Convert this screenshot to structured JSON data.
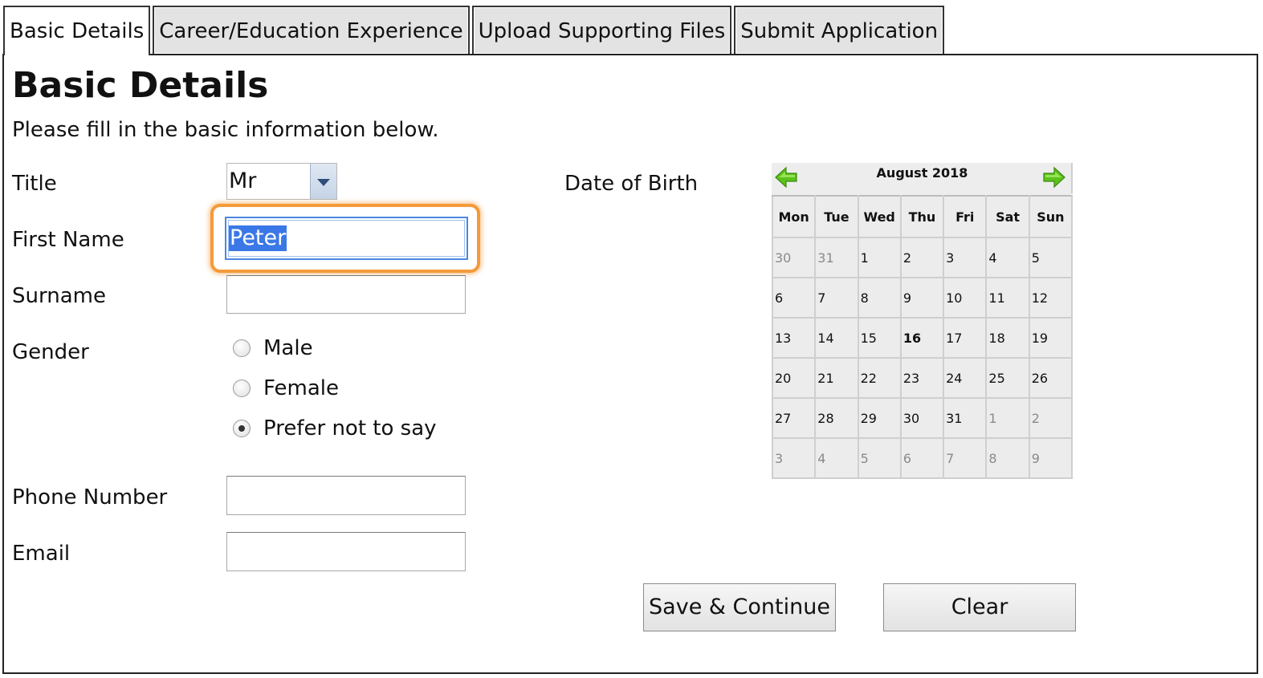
{
  "tabs": [
    {
      "label": "Basic Details"
    },
    {
      "label": "Career/Education Experience"
    },
    {
      "label": "Upload Supporting Files"
    },
    {
      "label": "Submit Application"
    }
  ],
  "page": {
    "title": "Basic Details",
    "instructions": "Please fill in the basic information below."
  },
  "form": {
    "title_label": "Title",
    "title_value": "Mr",
    "first_name_label": "First Name",
    "first_name_value": "Peter",
    "surname_label": "Surname",
    "surname_value": "",
    "gender_label": "Gender",
    "gender_options": [
      "Male",
      "Female",
      "Prefer not to say"
    ],
    "gender_selected": "Prefer not to say",
    "phone_label": "Phone Number",
    "phone_value": "",
    "email_label": "Email",
    "email_value": "",
    "dob_label": "Date of Birth"
  },
  "calendar": {
    "month_label": "August 2018",
    "weekdays": [
      "Mon",
      "Tue",
      "Wed",
      "Thu",
      "Fri",
      "Sat",
      "Sun"
    ],
    "highlighted_day": "16",
    "weeks": [
      [
        {
          "d": "30",
          "other": true
        },
        {
          "d": "31",
          "other": true
        },
        {
          "d": "1"
        },
        {
          "d": "2"
        },
        {
          "d": "3"
        },
        {
          "d": "4"
        },
        {
          "d": "5"
        }
      ],
      [
        {
          "d": "6"
        },
        {
          "d": "7"
        },
        {
          "d": "8"
        },
        {
          "d": "9"
        },
        {
          "d": "10"
        },
        {
          "d": "11"
        },
        {
          "d": "12"
        }
      ],
      [
        {
          "d": "13"
        },
        {
          "d": "14"
        },
        {
          "d": "15"
        },
        {
          "d": "16"
        },
        {
          "d": "17"
        },
        {
          "d": "18"
        },
        {
          "d": "19"
        }
      ],
      [
        {
          "d": "20"
        },
        {
          "d": "21"
        },
        {
          "d": "22"
        },
        {
          "d": "23"
        },
        {
          "d": "24"
        },
        {
          "d": "25"
        },
        {
          "d": "26"
        }
      ],
      [
        {
          "d": "27"
        },
        {
          "d": "28"
        },
        {
          "d": "29"
        },
        {
          "d": "30"
        },
        {
          "d": "31"
        },
        {
          "d": "1",
          "other": true
        },
        {
          "d": "2",
          "other": true
        }
      ],
      [
        {
          "d": "3",
          "other": true
        },
        {
          "d": "4",
          "other": true
        },
        {
          "d": "5",
          "other": true
        },
        {
          "d": "6",
          "other": true
        },
        {
          "d": "7",
          "other": true
        },
        {
          "d": "8",
          "other": true
        },
        {
          "d": "9",
          "other": true
        }
      ]
    ],
    "nav_prev_icon": "arrow-left-icon",
    "nav_next_icon": "arrow-right-icon",
    "arrow_color": "#5bc21b"
  },
  "buttons": {
    "save_label": "Save & Continue",
    "clear_label": "Clear"
  },
  "colors": {
    "focus_ring": "#f49a3a",
    "selection": "#3b78e7"
  }
}
